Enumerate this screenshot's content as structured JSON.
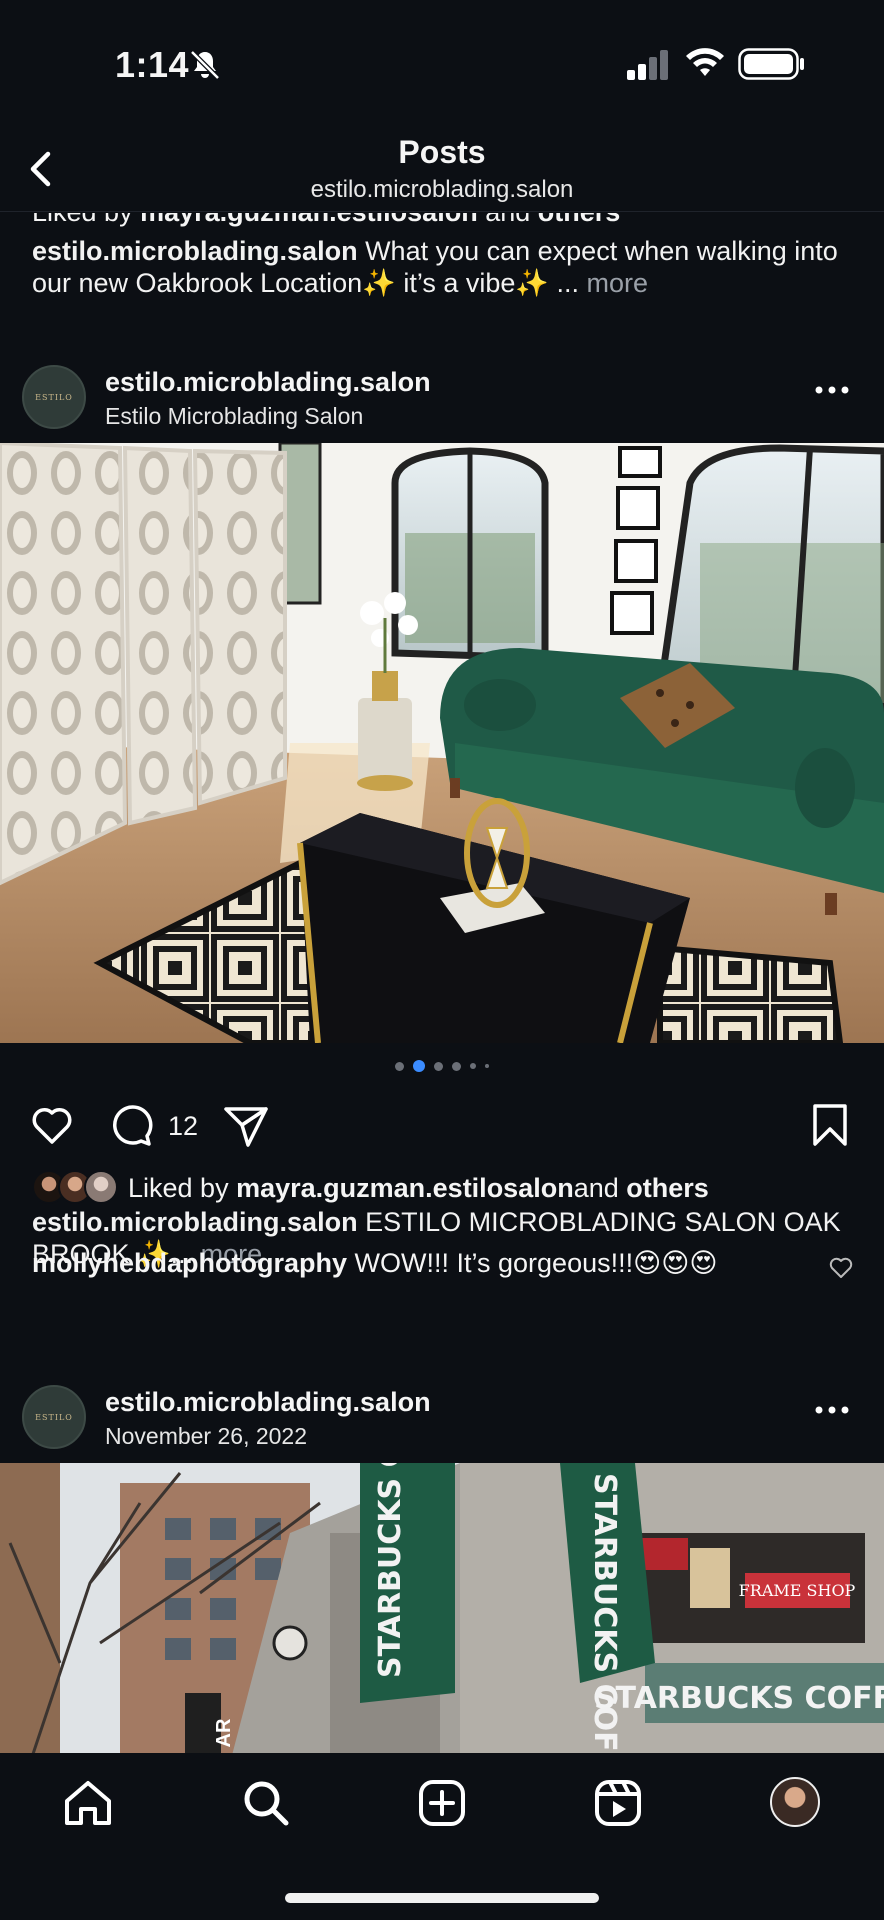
{
  "status_bar": {
    "time": "1:14"
  },
  "header": {
    "title": "Posts",
    "subtitle": "estilo.microblading.salon"
  },
  "top_post": {
    "liked_prefix": "Liked by ",
    "liked_user": "mayra.guzman.estilosalon",
    "liked_mid": " and ",
    "liked_others": "others",
    "caption_user": "estilo.microblading.salon",
    "caption_text": " What you can expect when walking into our new Oakbrook Location✨  it’s a vibe✨ ... ",
    "more": "more"
  },
  "post1": {
    "username": "estilo.microblading.salon",
    "subtitle": "Estilo Microblading Salon",
    "avatar_text": "ESTILO",
    "comment_count": "12",
    "liked_prefix": "Liked by ",
    "liked_user": "mayra.guzman.estilosalon",
    "liked_mid": " and ",
    "liked_others": "others",
    "caption_user": "estilo.microblading.salon",
    "caption_text": " ESTILO MICROBLADING SALON OAK BROOK  ✨... ",
    "more": "more",
    "comment_user": "mollyhebdaphotography",
    "comment_text": " WOW!!! It’s gorgeous!!!😍😍😍"
  },
  "post2": {
    "username": "estilo.microblading.salon",
    "date": "November 26, 2022",
    "avatar_text": "ESTILO",
    "banner_left": "STARBUCKS COFFEE",
    "banner_right": "STARBUCKS COFFEE",
    "store_sign": "STARBUCKS COFFEE",
    "window_sign": "FRAME SHOP",
    "pole_sign": "AR"
  },
  "carousel": {
    "total": 6,
    "active_index": 1
  },
  "nav": [
    "home-icon",
    "search-icon",
    "create-icon",
    "reels-icon",
    "profile-avatar"
  ]
}
